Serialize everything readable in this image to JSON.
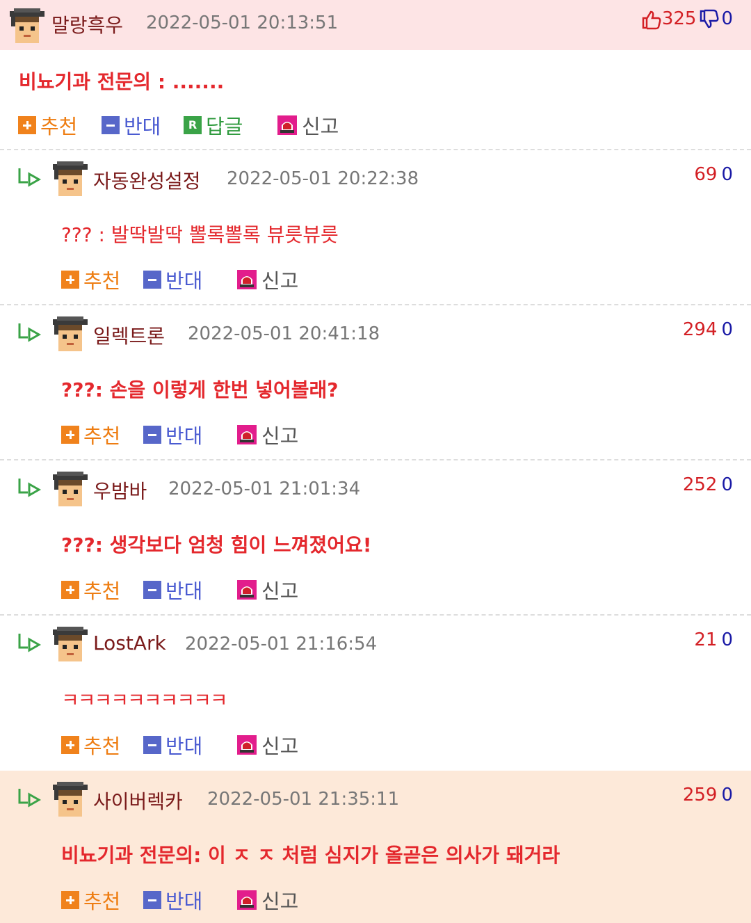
{
  "buttons": {
    "recommend": "추천",
    "oppose": "반대",
    "reply": "답글",
    "report": "신고",
    "reply_badge": "R"
  },
  "colors": {
    "accent_red": "#e4282d",
    "up": "#d31f24",
    "down": "#1a1aa6",
    "nick": "#7a1a1a",
    "header_pink": "#fde4e5",
    "highlight_peach": "#fde9d9"
  },
  "icons": {
    "thumbs_up": "thumbs-up-icon",
    "thumbs_down": "thumbs-down-icon",
    "reply_arrow": "reply-arrow-icon",
    "siren": "siren-icon",
    "avatar": "avatar-icon"
  },
  "comments": [
    {
      "nick": "말랑흑우",
      "date": "2022-05-01 20:13:51",
      "up": "325",
      "down": "0",
      "text": "비뇨기과 전문의 : ......."
    },
    {
      "nick": "자동완성설정",
      "date": "2022-05-01 20:22:38",
      "up": "69",
      "down": "0",
      "text": "??? : 발딱발딱 뽈록뽈록 뷰릇뷰릇"
    },
    {
      "nick": "일렉트론",
      "date": "2022-05-01 20:41:18",
      "up": "294",
      "down": "0",
      "text": "???: 손을 이렇게 한번 넣어볼래?"
    },
    {
      "nick": "우밤바",
      "date": "2022-05-01 21:01:34",
      "up": "252",
      "down": "0",
      "text": "???: 생각보다 엄청 힘이 느껴졌어요!"
    },
    {
      "nick": "LostArk",
      "date": "2022-05-01 21:16:54",
      "up": "21",
      "down": "0",
      "text": "ㅋㅋㅋㅋㅋㅋㅋㅋㅋㅋ"
    },
    {
      "nick": "사이버렉카",
      "date": "2022-05-01 21:35:11",
      "up": "259",
      "down": "0",
      "text": "비뇨기과 전문의: 이 ㅈ ㅈ 처럼 심지가 올곧은 의사가 돼거라"
    }
  ]
}
